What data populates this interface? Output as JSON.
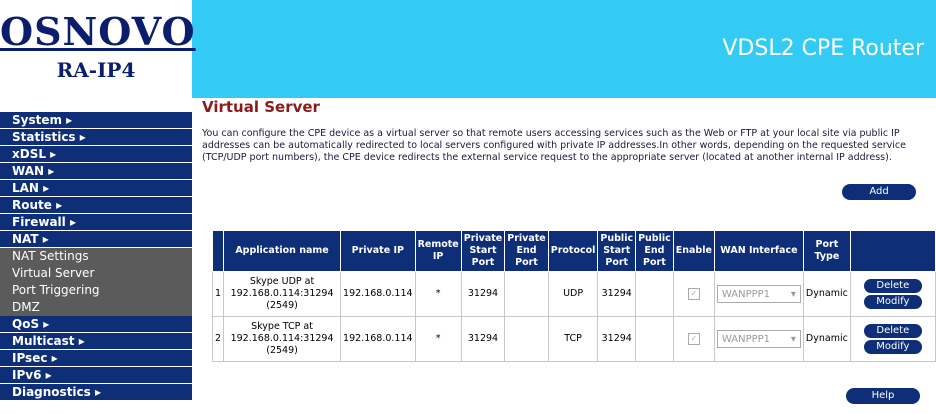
{
  "brand": {
    "name": "OSNOVO",
    "model": "RA-IP4",
    "product_title": "VDSL2 CPE Router"
  },
  "sidebar": {
    "items": [
      {
        "label": "System ▸"
      },
      {
        "label": "Statistics ▸"
      },
      {
        "label": "xDSL ▸"
      },
      {
        "label": "WAN ▸"
      },
      {
        "label": "LAN ▸"
      },
      {
        "label": "Route ▸"
      },
      {
        "label": "Firewall ▸"
      },
      {
        "label": "NAT ▸"
      }
    ],
    "nat_sub": [
      {
        "label": "NAT Settings"
      },
      {
        "label": "Virtual Server"
      },
      {
        "label": "Port Triggering"
      },
      {
        "label": "DMZ"
      }
    ],
    "items_after": [
      {
        "label": "QoS ▸"
      },
      {
        "label": "Multicast ▸"
      },
      {
        "label": "IPsec ▸"
      },
      {
        "label": "IPv6 ▸"
      },
      {
        "label": "Diagnostics ▸"
      }
    ]
  },
  "page": {
    "title": "Virtual Server",
    "description": "You can configure the CPE device as a virtual server so that remote users accessing services such as the Web or FTP at your local site via public IP addresses can be automatically redirected to local servers configured with private IP addresses.In other words, depending on the requested service (TCP/UDP port numbers), the CPE device redirects the external service request to the appropriate server (located at another internal IP address).",
    "add_label": "Add",
    "help_label": "Help"
  },
  "table": {
    "headers": [
      "Application name",
      "Private IP",
      "Remote IP",
      "Private Start Port",
      "Private End Port",
      "Protocol",
      "Public Start Port",
      "Public End Port",
      "Enable",
      "WAN Interface",
      "Port Type"
    ],
    "rows": [
      {
        "index": "1",
        "app": "Skype UDP at 192.168.0.114:31294 (2549)",
        "private_ip": "192.168.0.114",
        "remote_ip": "*",
        "priv_start": "31294",
        "priv_end": "",
        "protocol": "UDP",
        "pub_start": "31294",
        "pub_end": "",
        "wan": "WANPPP1",
        "port_type": "Dynamic",
        "delete": "Delete",
        "modify": "Modify"
      },
      {
        "index": "2",
        "app": "Skype TCP at 192.168.0.114:31294 (2549)",
        "private_ip": "192.168.0.114",
        "remote_ip": "*",
        "priv_start": "31294",
        "priv_end": "",
        "protocol": "TCP",
        "pub_start": "31294",
        "pub_end": "",
        "wan": "WANPPP1",
        "port_type": "Dynamic",
        "delete": "Delete",
        "modify": "Modify"
      }
    ]
  },
  "colors": {
    "header": "#33cbf3",
    "nav": "#0e2f78",
    "title": "#8b1a1a"
  }
}
